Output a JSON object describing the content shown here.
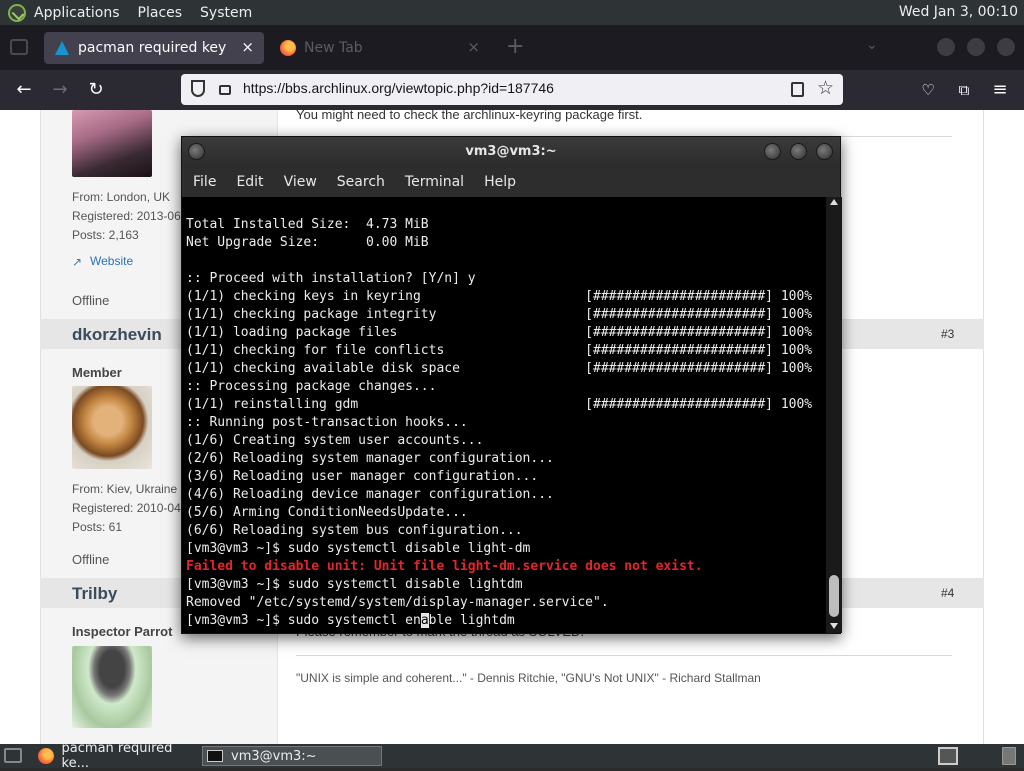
{
  "top_panel": {
    "applications": "Applications",
    "places": "Places",
    "system": "System",
    "clock": "Wed Jan  3, 00:10"
  },
  "browser": {
    "tabs": [
      {
        "title": "pacman required key missin",
        "close": "×"
      },
      {
        "title": "New Tab",
        "close": "×"
      }
    ],
    "new_tab": "+",
    "url": "https://bbs.archlinux.org/viewtopic.php?id=187746"
  },
  "forum": {
    "top_text": "You might need to check the archlinux-keyring package first.",
    "post2": {
      "from": "From: London, UK",
      "registered": "Registered: 2013-06",
      "posts": "Posts: 2,163",
      "website": "Website",
      "status": "Offline"
    },
    "post3": {
      "user": "dkorzhevin",
      "number": "#3",
      "role": "Member",
      "from": "From: Kiev, Ukraine",
      "registered": "Registered: 2010-04",
      "posts": "Posts: 61",
      "status": "Offline"
    },
    "post4": {
      "user": "Trilby",
      "number": "#4",
      "role": "Inspector Parrot",
      "body": "Please remember to mark the thread as SOLVED.",
      "signature": "\"UNIX is simple and coherent...\" - Dennis Ritchie, \"GNU's Not UNIX\" -  Richard Stallman"
    }
  },
  "terminal": {
    "title": "vm3@vm3:~",
    "menu": [
      "File",
      "Edit",
      "View",
      "Search",
      "Terminal",
      "Help"
    ],
    "lines": [
      "Total Installed Size:  4.73 MiB",
      "Net Upgrade Size:      0.00 MiB",
      "",
      ":: Proceed with installation? [Y/n] y",
      "(1/1) checking keys in keyring                     [######################] 100%",
      "(1/1) checking package integrity                   [######################] 100%",
      "(1/1) loading package files                        [######################] 100%",
      "(1/1) checking for file conflicts                  [######################] 100%",
      "(1/1) checking available disk space                [######################] 100%",
      ":: Processing package changes...",
      "(1/1) reinstalling gdm                             [######################] 100%",
      ":: Running post-transaction hooks...",
      "(1/6) Creating system user accounts...",
      "(2/6) Reloading system manager configuration...",
      "(3/6) Reloading user manager configuration...",
      "(4/6) Reloading device manager configuration...",
      "(5/6) Arming ConditionNeedsUpdate...",
      "(6/6) Reloading system bus configuration...",
      "[vm3@vm3 ~]$ sudo systemctl disable light-dm"
    ],
    "error_line": "Failed to disable unit: Unit file light-dm.service does not exist.",
    "after_lines": [
      "[vm3@vm3 ~]$ sudo systemctl disable lightdm",
      "Removed \"/etc/systemd/system/display-manager.service\"."
    ],
    "prompt_before_cursor": "[vm3@vm3 ~]$ sudo systemctl en",
    "cursor_char": "a",
    "prompt_after_cursor": "ble lightdm"
  },
  "taskbar": {
    "items": [
      {
        "label": "pacman required ke..."
      },
      {
        "label": "vm3@vm3:~"
      }
    ]
  }
}
